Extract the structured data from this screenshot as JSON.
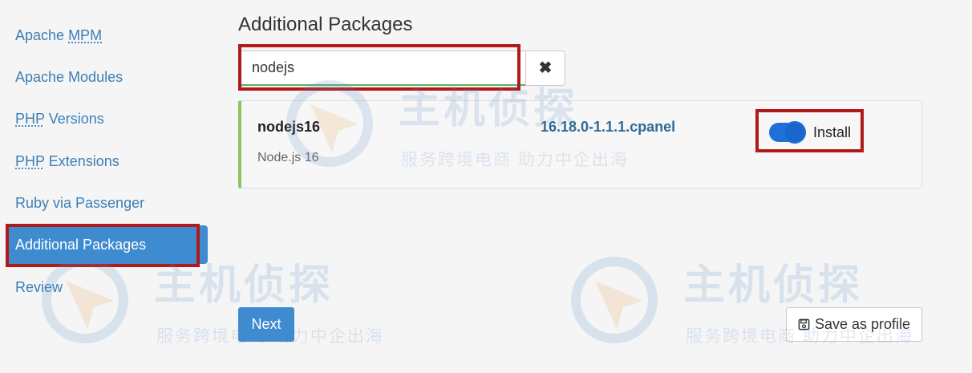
{
  "sidebar": {
    "items": [
      {
        "abbr": "MPM",
        "prefix": "Apache ",
        "suffix": ""
      },
      {
        "label": "Apache Modules"
      },
      {
        "abbr": "PHP",
        "prefix": "",
        "suffix": " Versions"
      },
      {
        "abbr": "PHP",
        "prefix": "",
        "suffix": " Extensions"
      },
      {
        "label": "Ruby via Passenger"
      },
      {
        "label": "Additional Packages"
      },
      {
        "label": "Review"
      }
    ]
  },
  "main": {
    "title": "Additional Packages",
    "search": {
      "value": "nodejs"
    },
    "clear_icon": "✖",
    "package": {
      "name": "nodejs16",
      "description": "Node.js 16",
      "version": "16.18.0-1.1.1.cpanel",
      "toggle_label": "Install",
      "toggle_on": true
    },
    "next_label": "Next",
    "save_profile_label": "Save as profile"
  },
  "watermark": {
    "main": "主机侦探",
    "sub": "服务跨境电商 助力中企出海"
  },
  "colors": {
    "accent": "#3e8bd0",
    "highlight": "#b01a1a",
    "link": "#3c7fb7",
    "success": "#8cc460",
    "toggle": "#1e6fd8"
  }
}
